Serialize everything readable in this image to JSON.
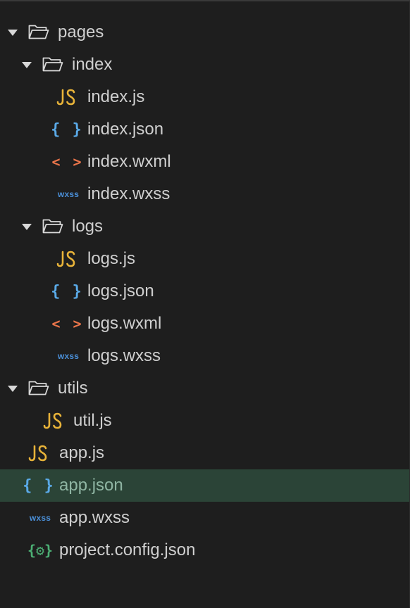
{
  "tree": {
    "rows": [
      {
        "label": "pages",
        "type": "folder",
        "depth": 0,
        "expanded": true
      },
      {
        "label": "index",
        "type": "folder",
        "depth": 1,
        "expanded": true
      },
      {
        "label": "index.js",
        "type": "js",
        "depth": 2
      },
      {
        "label": "index.json",
        "type": "json",
        "depth": 2
      },
      {
        "label": "index.wxml",
        "type": "wxml",
        "depth": 2
      },
      {
        "label": "index.wxss",
        "type": "wxss",
        "depth": 2
      },
      {
        "label": "logs",
        "type": "folder",
        "depth": 1,
        "expanded": true
      },
      {
        "label": "logs.js",
        "type": "js",
        "depth": 2
      },
      {
        "label": "logs.json",
        "type": "json",
        "depth": 2
      },
      {
        "label": "logs.wxml",
        "type": "wxml",
        "depth": 2
      },
      {
        "label": "logs.wxss",
        "type": "wxss",
        "depth": 2
      },
      {
        "label": "utils",
        "type": "folder",
        "depth": 0,
        "expanded": true
      },
      {
        "label": "util.js",
        "type": "js",
        "depth": 1
      },
      {
        "label": "app.js",
        "type": "js",
        "depth": 0
      },
      {
        "label": "app.json",
        "type": "json",
        "depth": 0,
        "selected": true
      },
      {
        "label": "app.wxss",
        "type": "wxss",
        "depth": 0
      },
      {
        "label": "project.config.json",
        "type": "config",
        "depth": 0
      }
    ]
  },
  "icons": {
    "js": {
      "name": "js-file-icon",
      "glyph": "JS",
      "color": "#e8b339"
    },
    "json": {
      "name": "json-file-icon",
      "glyph": "{ }",
      "color": "#5aa9e6"
    },
    "wxml": {
      "name": "wxml-file-icon",
      "glyph": "< >",
      "color": "#e8744a"
    },
    "wxss": {
      "name": "wxss-file-icon",
      "glyph": "wxss",
      "color": "#4a8fd8"
    },
    "config": {
      "name": "config-file-icon",
      "glyph": "{⚙}",
      "color": "#4caf74"
    },
    "folder": {
      "name": "folder-open-icon",
      "color": "#d8d8d8"
    },
    "caret": {
      "name": "chevron-down-icon",
      "color": "#d8d8d8"
    }
  },
  "colors": {
    "background": "#1e1e1e",
    "text": "#cfcfcf",
    "selected_background": "#2b4437",
    "selected_text": "#8fb5a3"
  }
}
